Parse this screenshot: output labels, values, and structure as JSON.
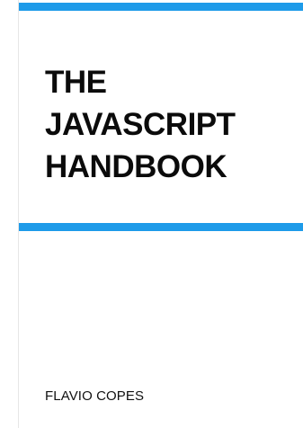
{
  "cover": {
    "title_lines": [
      "THE",
      "JAVASCRIPT",
      "HANDBOOK"
    ],
    "author": "FLAVIO COPES",
    "accent_color": "#1e9be9"
  }
}
